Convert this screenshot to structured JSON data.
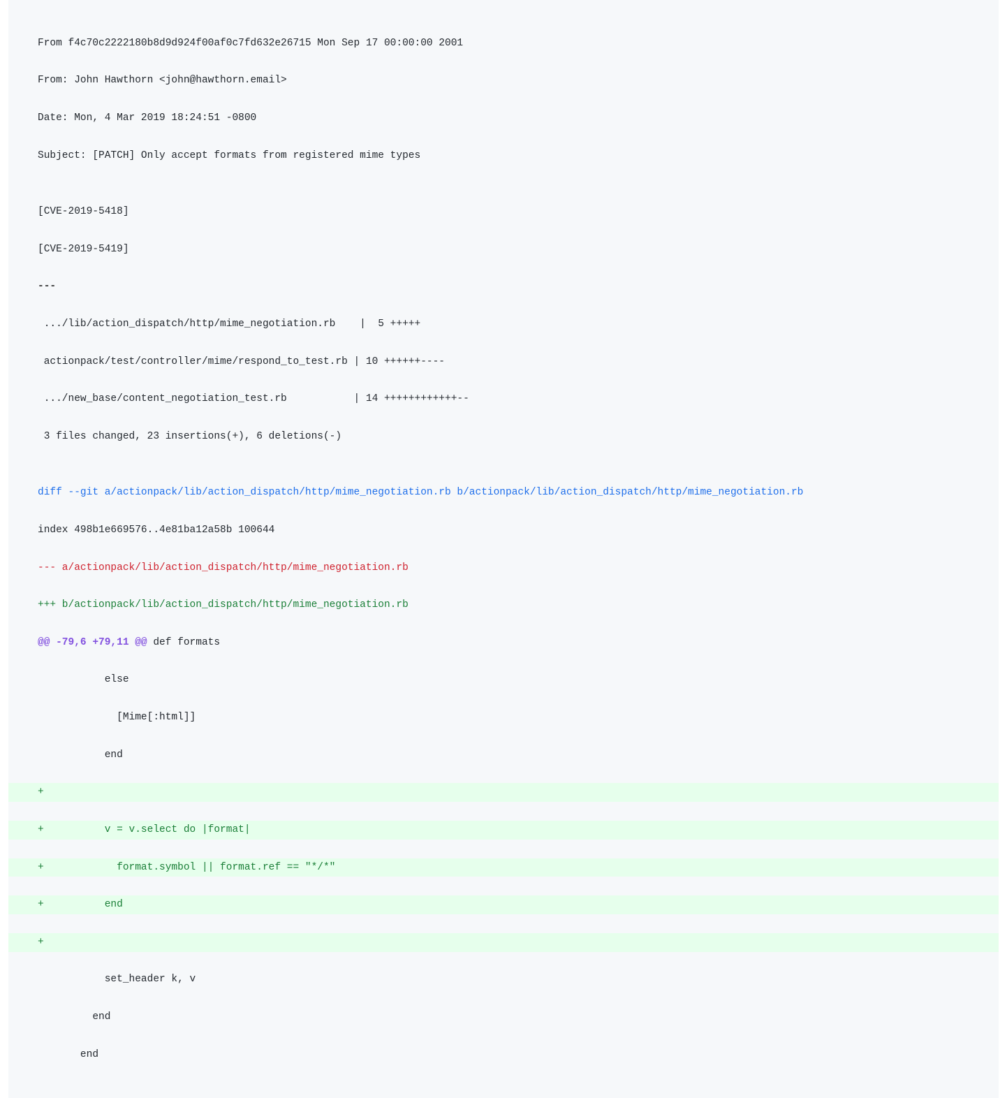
{
  "patch": {
    "header": [
      "From f4c70c2222180b8d9d924f00af0c7fd632e26715 Mon Sep 17 00:00:00 2001",
      "From: John Hawthorn <john@hawthorn.email>",
      "Date: Mon, 4 Mar 2019 18:24:51 -0800",
      "Subject: [PATCH] Only accept formats from registered mime types",
      "",
      "[CVE-2019-5418]",
      "[CVE-2019-5419]"
    ],
    "sep": "---",
    "diffstat": [
      " .../lib/action_dispatch/http/mime_negotiation.rb    |  5 +++++",
      " actionpack/test/controller/mime/respond_to_test.rb | 10 ++++++----",
      " .../new_base/content_negotiation_test.rb           | 14 ++++++++++++--",
      " 3 files changed, 23 insertions(+), 6 deletions(-)",
      ""
    ],
    "diffcmd": "diff --git a/actionpack/lib/action_dispatch/http/mime_negotiation.rb b/actionpack/lib/action_dispatch/http/mime_negotiation.rb",
    "index": "index 498b1e669576..4e81ba12a58b 100644",
    "fileminus": "--- a/actionpack/lib/action_dispatch/http/mime_negotiation.rb",
    "fileplus": "+++ b/actionpack/lib/action_dispatch/http/mime_negotiation.rb",
    "hunkrange": "@@ -79,6 +79,11 @@",
    "hunkcontext": " def formats",
    "body": [
      {
        "type": "ctx",
        "text": "           else"
      },
      {
        "type": "ctx",
        "text": "             [Mime[:html]]"
      },
      {
        "type": "ctx",
        "text": "           end"
      },
      {
        "type": "add",
        "text": "+"
      },
      {
        "type": "add",
        "text": "+          v = v.select do |format|"
      },
      {
        "type": "add",
        "text": "+            format.symbol || format.ref == \"*/*\""
      },
      {
        "type": "add",
        "text": "+          end"
      },
      {
        "type": "add",
        "text": "+"
      },
      {
        "type": "ctx",
        "text": "           set_header k, v"
      },
      {
        "type": "ctx",
        "text": "         end"
      },
      {
        "type": "ctx",
        "text": "       end"
      }
    ]
  }
}
